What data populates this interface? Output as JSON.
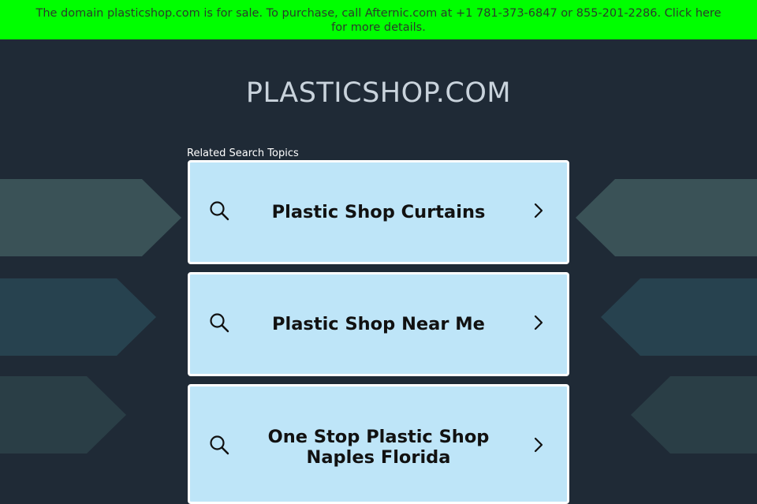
{
  "banner": {
    "text": "The domain plasticshop.com is for sale. To purchase, call Afternic.com at +1 781-373-6847 or 855-201-2286. Click here for more details."
  },
  "site": {
    "title": "PLASTICSHOP.COM"
  },
  "related": {
    "label": "Related Search Topics",
    "items": [
      {
        "label": "Plastic Shop Curtains",
        "icon": "search-icon",
        "arrow": "chevron-right-icon"
      },
      {
        "label": "Plastic Shop Near Me",
        "icon": "search-icon",
        "arrow": "chevron-right-icon"
      },
      {
        "label": "One Stop Plastic Shop Naples Florida",
        "icon": "search-icon",
        "arrow": "chevron-right-icon"
      }
    ]
  },
  "colors": {
    "banner": "#00ff00",
    "background": "#1f2a36",
    "card": "#bee5f8",
    "card_border": "#ffffff"
  }
}
